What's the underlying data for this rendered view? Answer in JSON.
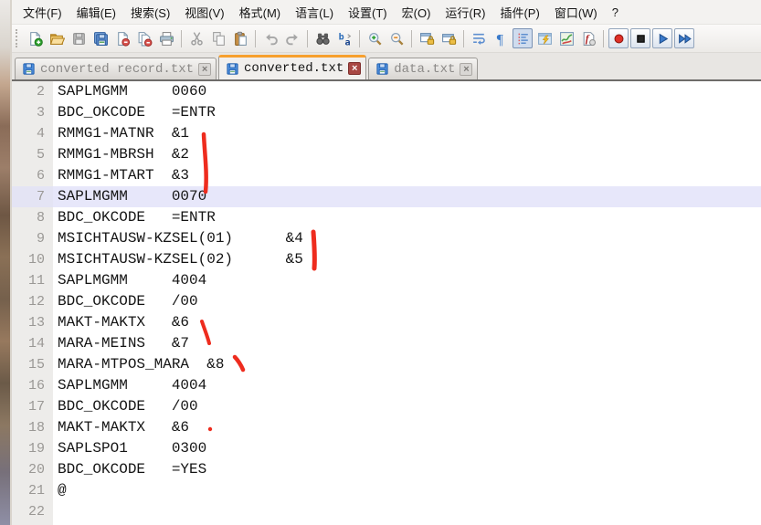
{
  "menu": {
    "items": [
      {
        "key": "file",
        "label": "文件(F)"
      },
      {
        "key": "edit",
        "label": "编辑(E)"
      },
      {
        "key": "search",
        "label": "搜索(S)"
      },
      {
        "key": "view",
        "label": "视图(V)"
      },
      {
        "key": "format",
        "label": "格式(M)"
      },
      {
        "key": "language",
        "label": "语言(L)"
      },
      {
        "key": "settings",
        "label": "设置(T)"
      },
      {
        "key": "macro",
        "label": "宏(O)"
      },
      {
        "key": "run",
        "label": "运行(R)"
      },
      {
        "key": "plugins",
        "label": "插件(P)"
      },
      {
        "key": "window",
        "label": "窗口(W)"
      },
      {
        "key": "help",
        "label": "?"
      }
    ]
  },
  "toolbar": {
    "buttons": [
      {
        "name": "new-file",
        "enabled": true
      },
      {
        "name": "open-file",
        "enabled": true
      },
      {
        "name": "save-file",
        "enabled": false
      },
      {
        "name": "save-all",
        "enabled": true
      },
      {
        "name": "close-file",
        "enabled": true
      },
      {
        "name": "close-all",
        "enabled": true
      },
      {
        "name": "print",
        "enabled": true
      },
      {
        "separator": true
      },
      {
        "name": "cut",
        "enabled": false
      },
      {
        "name": "copy",
        "enabled": false
      },
      {
        "name": "paste",
        "enabled": true
      },
      {
        "separator": true
      },
      {
        "name": "undo",
        "enabled": false
      },
      {
        "name": "redo",
        "enabled": false
      },
      {
        "separator": true
      },
      {
        "name": "find",
        "enabled": true
      },
      {
        "name": "replace",
        "enabled": true
      },
      {
        "separator": true
      },
      {
        "name": "zoom-in",
        "enabled": true
      },
      {
        "name": "zoom-out",
        "enabled": true
      },
      {
        "separator": true
      },
      {
        "name": "sync-vertical-scroll",
        "enabled": true
      },
      {
        "name": "sync-horizontal-scroll",
        "enabled": true
      },
      {
        "separator": true
      },
      {
        "name": "word-wrap",
        "enabled": true
      },
      {
        "name": "show-all-characters",
        "enabled": true
      },
      {
        "name": "show-indent-guide",
        "enabled": true,
        "pressed": true
      },
      {
        "name": "user-defined-language",
        "enabled": true
      },
      {
        "name": "document-map",
        "enabled": true
      },
      {
        "name": "function-list",
        "enabled": true
      },
      {
        "separator": true
      },
      {
        "name": "macro-record",
        "enabled": true,
        "framed": true
      },
      {
        "name": "macro-stop",
        "enabled": true,
        "framed": true
      },
      {
        "name": "macro-play",
        "enabled": true,
        "framed": true
      },
      {
        "name": "macro-run-multiple",
        "enabled": true,
        "framed": true
      }
    ]
  },
  "tabbar": {
    "close_glyph": "×",
    "tabs": [
      {
        "label": "converted record.txt",
        "active": false
      },
      {
        "label": "converted.txt",
        "active": true
      },
      {
        "label": "data.txt",
        "active": false
      }
    ]
  },
  "editor": {
    "colors": {
      "text": "#141414",
      "line_number": "#9A9895",
      "current_line_bg": "#E7E7FA",
      "gutter_bg": "#EDECEA",
      "active_tab_accent": "#F7A02E"
    },
    "lines": [
      {
        "n": 2,
        "text": "SAPLMGMM     0060"
      },
      {
        "n": 3,
        "text": "BDC_OKCODE   =ENTR"
      },
      {
        "n": 4,
        "text": "RMMG1-MATNR  &1"
      },
      {
        "n": 5,
        "text": "RMMG1-MBRSH  &2"
      },
      {
        "n": 6,
        "text": "RMMG1-MTART  &3"
      },
      {
        "n": 7,
        "text": "SAPLMGMM     0070",
        "current": true
      },
      {
        "n": 8,
        "text": "BDC_OKCODE   =ENTR"
      },
      {
        "n": 9,
        "text": "MSICHTAUSW-KZSEL(01)      &4"
      },
      {
        "n": 10,
        "text": "MSICHTAUSW-KZSEL(02)      &5"
      },
      {
        "n": 11,
        "text": "SAPLMGMM     4004"
      },
      {
        "n": 12,
        "text": "BDC_OKCODE   /00"
      },
      {
        "n": 13,
        "text": "MAKT-MAKTX   &6"
      },
      {
        "n": 14,
        "text": "MARA-MEINS   &7"
      },
      {
        "n": 15,
        "text": "MARA-MTPOS_MARA  &8"
      },
      {
        "n": 16,
        "text": "SAPLMGMM     4004"
      },
      {
        "n": 17,
        "text": "BDC_OKCODE   /00"
      },
      {
        "n": 18,
        "text": "MAKT-MAKTX   &6"
      },
      {
        "n": 19,
        "text": "SAPLSPO1     0300"
      },
      {
        "n": 20,
        "text": "BDC_OKCODE   =YES"
      },
      {
        "n": 21,
        "text": "@"
      },
      {
        "n": 22,
        "text": ""
      }
    ]
  },
  "annotations": {
    "pen_color": "#EE2C1E",
    "marks": [
      {
        "id": "stroke-beside-lines-4-7"
      },
      {
        "id": "stroke-beside-lines-9-10"
      },
      {
        "id": "stroke-beside-lines-13-14"
      },
      {
        "id": "stroke-beside-line-15"
      },
      {
        "id": "dot-beside-line-18"
      }
    ]
  }
}
